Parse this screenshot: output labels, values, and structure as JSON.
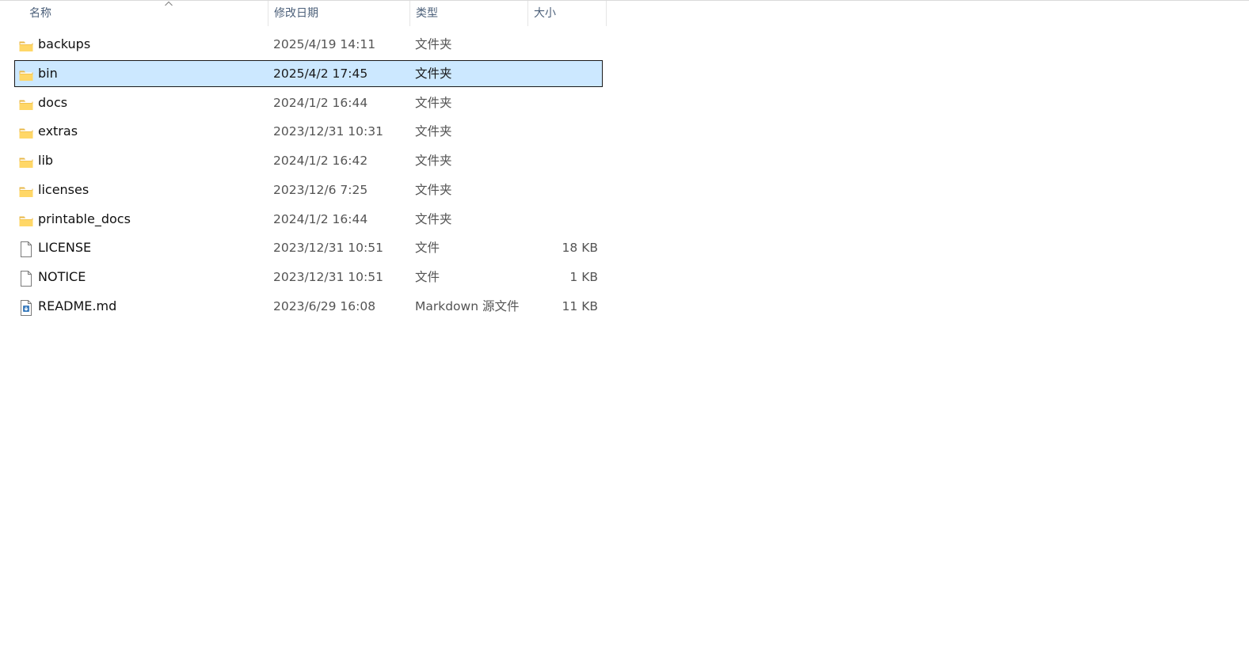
{
  "columns": {
    "name": "名称",
    "date": "修改日期",
    "type": "类型",
    "size": "大小"
  },
  "files": [
    {
      "name": "backups",
      "date": "2025/4/19 14:11",
      "type": "文件夹",
      "size": "",
      "icon": "folder-icon",
      "selected": false
    },
    {
      "name": "bin",
      "date": "2025/4/2 17:45",
      "type": "文件夹",
      "size": "",
      "icon": "folder-icon",
      "selected": true
    },
    {
      "name": "docs",
      "date": "2024/1/2 16:44",
      "type": "文件夹",
      "size": "",
      "icon": "folder-icon",
      "selected": false
    },
    {
      "name": "extras",
      "date": "2023/12/31 10:31",
      "type": "文件夹",
      "size": "",
      "icon": "folder-icon",
      "selected": false
    },
    {
      "name": "lib",
      "date": "2024/1/2 16:42",
      "type": "文件夹",
      "size": "",
      "icon": "folder-icon",
      "selected": false
    },
    {
      "name": "licenses",
      "date": "2023/12/6 7:25",
      "type": "文件夹",
      "size": "",
      "icon": "folder-icon",
      "selected": false
    },
    {
      "name": "printable_docs",
      "date": "2024/1/2 16:44",
      "type": "文件夹",
      "size": "",
      "icon": "folder-icon",
      "selected": false
    },
    {
      "name": "LICENSE",
      "date": "2023/12/31 10:51",
      "type": "文件",
      "size": "18 KB",
      "icon": "file-icon",
      "selected": false
    },
    {
      "name": "NOTICE",
      "date": "2023/12/31 10:51",
      "type": "文件",
      "size": "1 KB",
      "icon": "file-icon",
      "selected": false
    },
    {
      "name": "README.md",
      "date": "2023/6/29 16:08",
      "type": "Markdown 源文件",
      "size": "11 KB",
      "icon": "markdown-file-icon",
      "selected": false
    }
  ],
  "colors": {
    "selection_bg": "#cce8ff",
    "header_text": "#4c607a",
    "folder_yellow": "#ffd767"
  }
}
